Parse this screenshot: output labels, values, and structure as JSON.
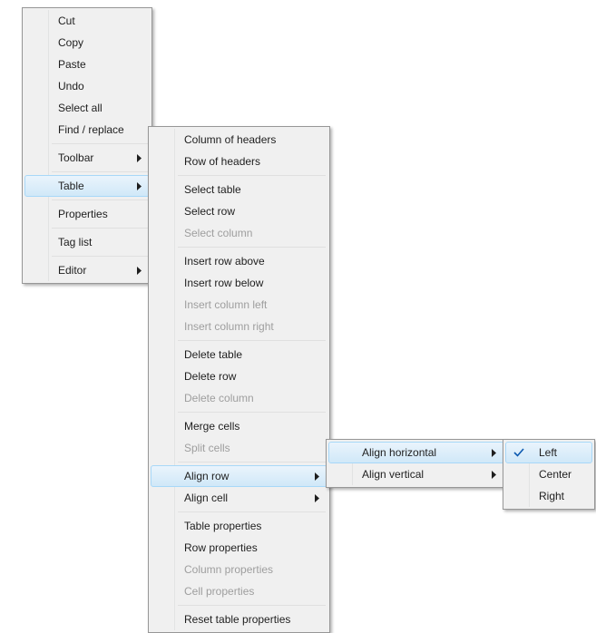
{
  "menu1": {
    "items": [
      {
        "label": "Cut"
      },
      {
        "label": "Copy"
      },
      {
        "label": "Paste"
      },
      {
        "label": "Undo"
      },
      {
        "label": "Select all"
      },
      {
        "label": "Find / replace"
      }
    ],
    "toolbar": "Toolbar",
    "table": "Table",
    "properties": "Properties",
    "taglist": "Tag list",
    "editor": "Editor"
  },
  "menu2": {
    "col_headers": "Column of headers",
    "row_headers": "Row of headers",
    "select_table": "Select table",
    "select_row": "Select row",
    "select_column": "Select column",
    "insert_row_above": "Insert row above",
    "insert_row_below": "Insert row below",
    "insert_col_left": "Insert column left",
    "insert_col_right": "Insert column right",
    "delete_table": "Delete table",
    "delete_row": "Delete row",
    "delete_column": "Delete column",
    "merge_cells": "Merge cells",
    "split_cells": "Split cells",
    "align_row": "Align row",
    "align_cell": "Align cell",
    "table_props": "Table properties",
    "row_props": "Row properties",
    "col_props": "Column properties",
    "cell_props": "Cell properties",
    "reset_props": "Reset table properties"
  },
  "menu3": {
    "align_h": "Align horizontal",
    "align_v": "Align vertical"
  },
  "menu4": {
    "left": "Left",
    "center": "Center",
    "right": "Right"
  }
}
